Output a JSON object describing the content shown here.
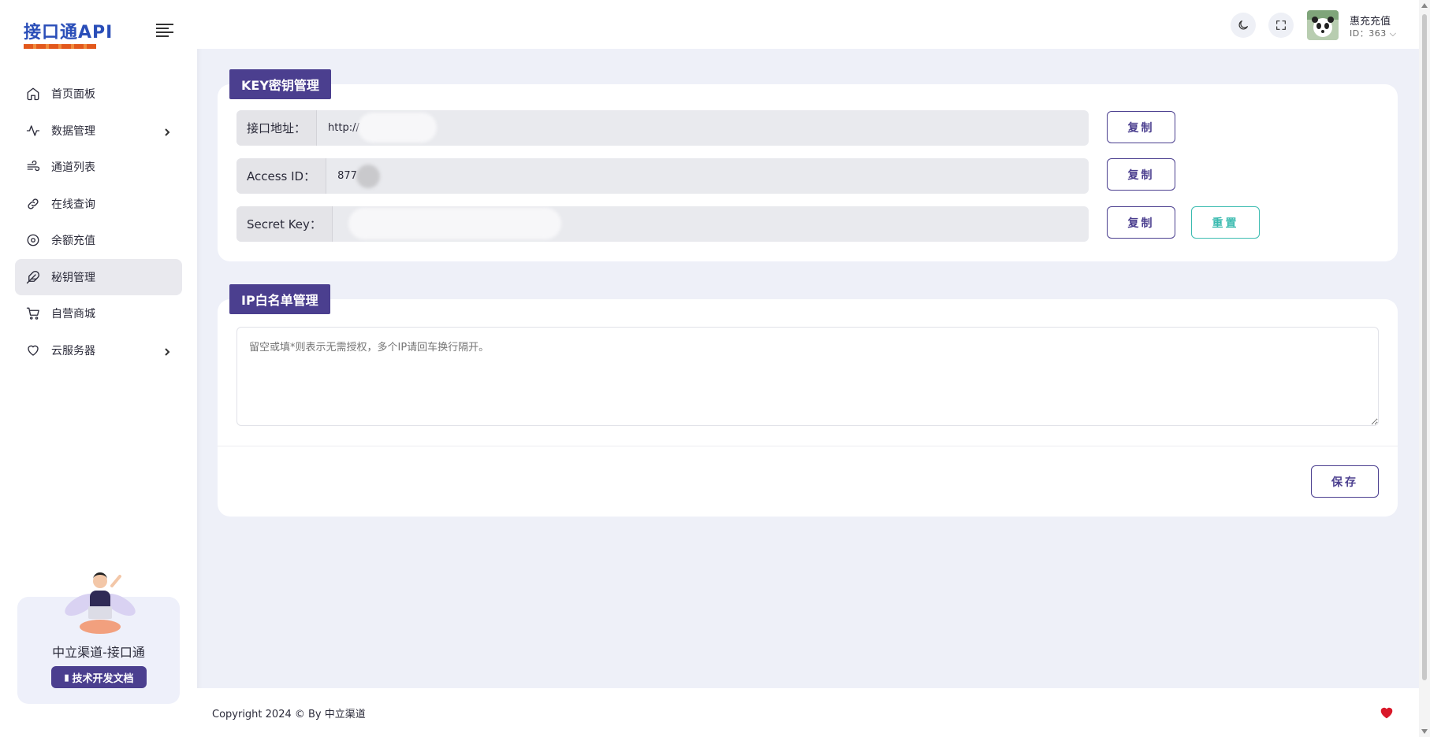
{
  "brand": {
    "logo_text": "接口通API"
  },
  "sidebar": {
    "items": [
      {
        "label": "首页面板",
        "icon": "home-icon",
        "active": false,
        "has_children": false
      },
      {
        "label": "数据管理",
        "icon": "activity-icon",
        "active": false,
        "has_children": true
      },
      {
        "label": "通道列表",
        "icon": "wind-icon",
        "active": false,
        "has_children": false
      },
      {
        "label": "在线查询",
        "icon": "link-icon",
        "active": false,
        "has_children": false
      },
      {
        "label": "余额充值",
        "icon": "target-icon",
        "active": false,
        "has_children": false
      },
      {
        "label": "秘钥管理",
        "icon": "feather-icon",
        "active": true,
        "has_children": false
      },
      {
        "label": "自营商城",
        "icon": "cart-icon",
        "active": false,
        "has_children": false
      },
      {
        "label": "云服务器",
        "icon": "heart-icon",
        "active": false,
        "has_children": true
      }
    ],
    "promo": {
      "title": "中立渠道-接口通",
      "button_label": "技术开发文档"
    }
  },
  "header": {
    "user_name": "惠充充值",
    "user_id": "ID：363"
  },
  "key_section": {
    "title": "KEY密钥管理",
    "fields": [
      {
        "label": "接口地址：",
        "value": "http://"
      },
      {
        "label": "Access ID：",
        "value": "877"
      },
      {
        "label": "Secret Key：",
        "value": ""
      }
    ],
    "copy_label": "复制",
    "reset_label": "重置"
  },
  "ip_section": {
    "title": "IP白名单管理",
    "placeholder": "留空或填*则表示无需授权，多个IP请回车换行隔开。",
    "save_label": "保存"
  },
  "footer": {
    "copyright": "Copyright 2024 © By 中立渠道"
  },
  "colors": {
    "accent": "#4b3f8f",
    "teal": "#3bbbb0",
    "background": "#eef0f8",
    "heart": "#d9192a"
  }
}
